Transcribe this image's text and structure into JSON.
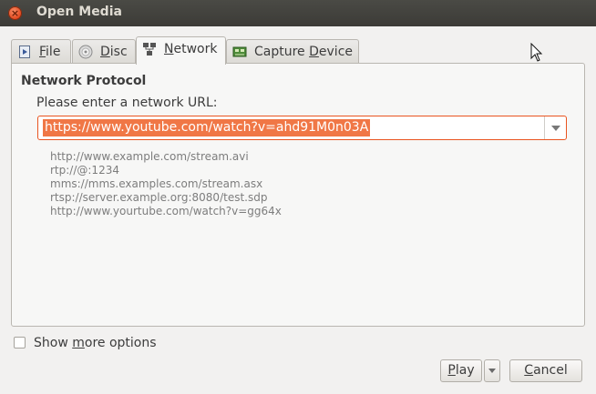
{
  "window": {
    "title": "Open Media"
  },
  "tabs": [
    {
      "name": "tab-file",
      "label": "File",
      "mnemonic": "F",
      "rest": "ile",
      "icon": "file-icon"
    },
    {
      "name": "tab-disc",
      "label": "Disc",
      "mnemonic": "D",
      "rest": "isc",
      "icon": "disc-icon"
    },
    {
      "name": "tab-network",
      "label": "Network",
      "mnemonic": "N",
      "rest": "etwork",
      "icon": "network-icon",
      "active": true
    },
    {
      "name": "tab-capture-device",
      "label": "Capture Device",
      "prefix": "Capture ",
      "mnemonic": "D",
      "rest": "evice",
      "icon": "capture-card-icon"
    }
  ],
  "network": {
    "section_title": "Network Protocol",
    "prompt": "Please enter a network URL:",
    "url_value": "https://www.youtube.com/watch?v=ahd91M0n03A",
    "examples": [
      "http://www.example.com/stream.avi",
      "rtp://@:1234",
      "mms://mms.examples.com/stream.asx",
      "rtsp://server.example.org:8080/test.sdp",
      "http://www.yourtube.com/watch?v=gg64x"
    ]
  },
  "options": {
    "show_more_label": "Show more options",
    "show_more_prefix": "Show ",
    "show_more_mnemonic": "m",
    "show_more_rest": "ore options",
    "checked": false
  },
  "buttons": {
    "play_label": "Play",
    "play_mnemonic": "P",
    "play_rest": "lay",
    "cancel_label": "Cancel",
    "cancel_mnemonic": "C",
    "cancel_rest": "ancel"
  },
  "colors": {
    "accent": "#e95420",
    "selection": "#f07746",
    "titlebar": "#3c3b37"
  }
}
